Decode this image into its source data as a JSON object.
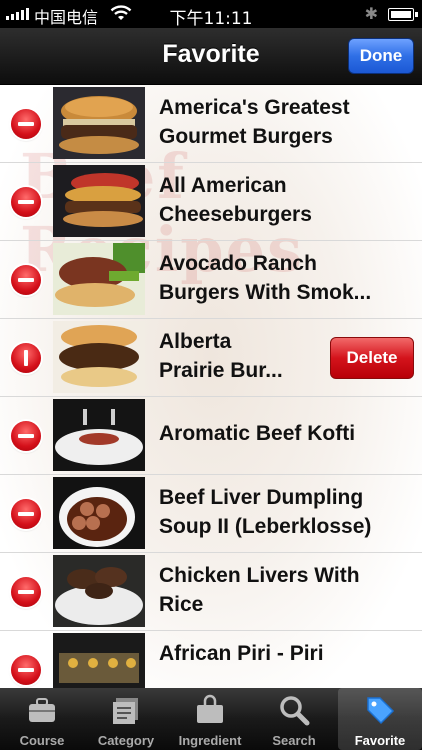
{
  "status_bar": {
    "carrier": "中国电信",
    "time": "下午11:11"
  },
  "nav": {
    "title": "Favorite",
    "done_label": "Done"
  },
  "watermark": "Beef Recipes",
  "rows": [
    {
      "line1": "America's Greatest",
      "line2": "Gourmet Burgers"
    },
    {
      "line1": "All American",
      "line2": "Cheeseburgers"
    },
    {
      "line1": "Avocado Ranch",
      "line2": "Burgers With Smok..."
    },
    {
      "line1": "Alberta",
      "line2": "Prairie Bur...",
      "delete_label": "Delete"
    },
    {
      "line1": "Aromatic Beef Kofti",
      "line2": ""
    },
    {
      "line1": "Beef Liver Dumpling",
      "line2": "Soup II (Leberklosse)"
    },
    {
      "line1": "Chicken Livers With",
      "line2": "Rice"
    },
    {
      "line1": "African Piri - Piri",
      "line2": ""
    }
  ],
  "tabs": [
    {
      "label": "Course",
      "icon": "briefcase-icon"
    },
    {
      "label": "Category",
      "icon": "category-icon"
    },
    {
      "label": "Ingredient",
      "icon": "bag-icon"
    },
    {
      "label": "Search",
      "icon": "search-icon"
    },
    {
      "label": "Favorite",
      "icon": "tag-icon"
    }
  ]
}
